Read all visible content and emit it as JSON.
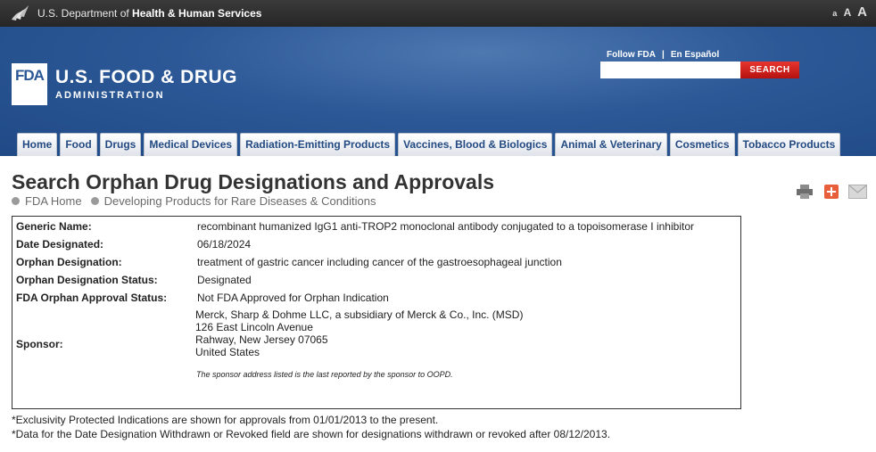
{
  "topbar": {
    "hhs_prefix": "U.S. Department of ",
    "hhs_bold": "Health & Human Services",
    "font_small": "a",
    "font_medium": "A",
    "font_large": "A"
  },
  "header": {
    "logo_mark": "FDA",
    "logo_title": "U.S. FOOD & DRUG",
    "logo_subtitle": "ADMINISTRATION",
    "follow_fda": "Follow FDA",
    "separator": "|",
    "en_espanol": "En Español",
    "search_placeholder": "",
    "search_button": "SEARCH"
  },
  "nav": {
    "tabs": [
      "Home",
      "Food",
      "Drugs",
      "Medical Devices",
      "Radiation-Emitting Products",
      "Vaccines, Blood & Biologics",
      "Animal & Veterinary",
      "Cosmetics",
      "Tobacco Products"
    ]
  },
  "page": {
    "title": "Search Orphan Drug Designations and Approvals",
    "breadcrumb": [
      "FDA Home",
      "Developing Products for Rare Diseases & Conditions"
    ]
  },
  "details": {
    "generic_name_label": "Generic Name:",
    "generic_name": "recombinant humanized IgG1 anti-TROP2 monoclonal antibody conjugated to a topoisomerase I inhibitor",
    "date_designated_label": "Date Designated:",
    "date_designated": "06/18/2024",
    "orphan_designation_label": "Orphan Designation:",
    "orphan_designation": "treatment of gastric cancer including cancer of the gastroesophageal junction",
    "designation_status_label": "Orphan Designation Status:",
    "designation_status": "Designated",
    "approval_status_label": "FDA Orphan Approval Status:",
    "approval_status": "Not FDA Approved for Orphan Indication",
    "sponsor_label": "Sponsor:",
    "sponsor_lines": [
      "Merck, Sharp & Dohme LLC, a subsidiary of Merck & Co., Inc. (MSD)",
      "126 East Lincoln Avenue",
      "Rahway, New Jersey 07065",
      "United States"
    ],
    "sponsor_note": "The sponsor address listed is the last reported by the sponsor to OOPD."
  },
  "footnotes": [
    "*Exclusivity Protected Indications are shown for approvals from 01/01/2013 to the present.",
    "*Data for the Date Designation Withdrawn or Revoked field are shown for designations withdrawn or revoked after 08/12/2013."
  ]
}
